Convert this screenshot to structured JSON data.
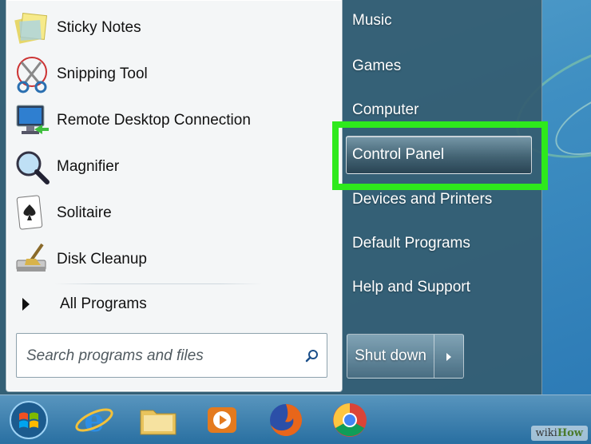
{
  "programs": [
    {
      "label": "Sticky Notes",
      "icon": "sticky-notes-icon"
    },
    {
      "label": "Snipping Tool",
      "icon": "snipping-tool-icon"
    },
    {
      "label": "Remote Desktop Connection",
      "icon": "remote-desktop-icon"
    },
    {
      "label": "Magnifier",
      "icon": "magnifier-icon"
    },
    {
      "label": "Solitaire",
      "icon": "solitaire-icon"
    },
    {
      "label": "Disk Cleanup",
      "icon": "disk-cleanup-icon"
    }
  ],
  "all_programs_label": "All Programs",
  "search": {
    "placeholder": "Search programs and files"
  },
  "right_menu": {
    "music": "Music",
    "games": "Games",
    "computer": "Computer",
    "control_panel": "Control Panel",
    "devices_printers": "Devices and Printers",
    "default_programs": "Default Programs",
    "help_support": "Help and Support"
  },
  "shutdown_label": "Shut down",
  "highlight_color": "#2ee91c",
  "taskbar_icons": [
    "start-orb-icon",
    "internet-explorer-icon",
    "file-explorer-icon",
    "media-player-icon",
    "firefox-icon",
    "chrome-icon"
  ],
  "watermark": {
    "prefix": "wiki",
    "brand": "How"
  }
}
